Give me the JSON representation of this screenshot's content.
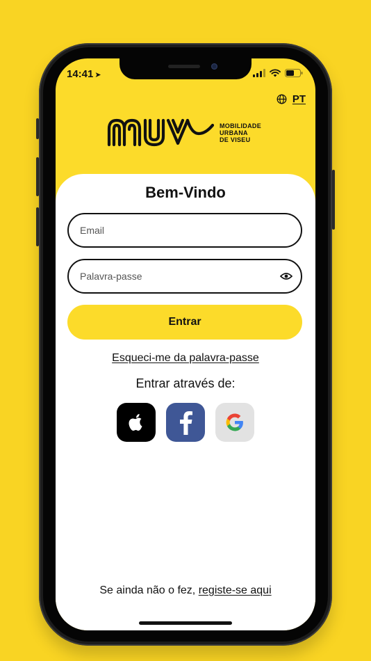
{
  "status_bar": {
    "time": "14:41"
  },
  "language": {
    "code": "PT"
  },
  "logo": {
    "brand": "MUV",
    "subtitle_lines": [
      "MOBILIDADE",
      "URBANA",
      "DE VISEU"
    ]
  },
  "login": {
    "title": "Bem-Vindo",
    "email_placeholder": "Email",
    "password_placeholder": "Palavra-passe",
    "submit_label": "Entrar",
    "forgot_label": "Esqueci-me da palavra-passe",
    "social_title": "Entrar através de:"
  },
  "social": [
    {
      "icon": "apple-icon"
    },
    {
      "icon": "facebook-icon"
    },
    {
      "icon": "google-icon"
    }
  ],
  "footer": {
    "register_prefix": "Se ainda não o fez,",
    "register_link": "registe-se aqui"
  },
  "colors": {
    "brand_yellow": "#FCDB2A",
    "background_yellow": "#F9D423",
    "facebook_blue": "#3F5796"
  }
}
